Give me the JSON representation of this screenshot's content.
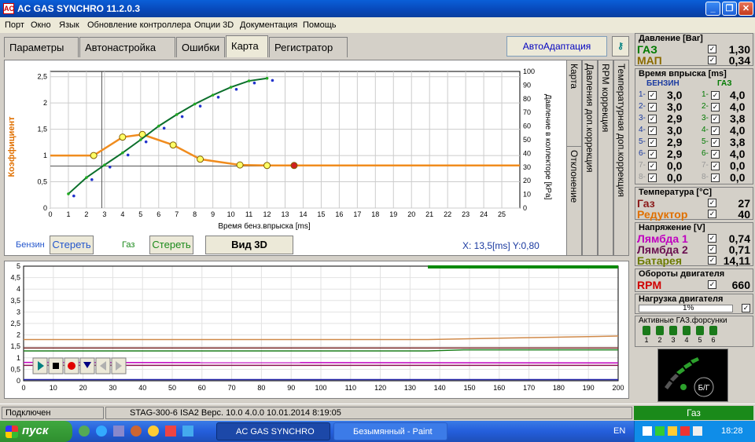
{
  "window": {
    "title": "AC GAS SYNCHRO  11.2.0.3",
    "app_icon": "AC"
  },
  "menu": [
    "Порт",
    "Окно",
    "Язык",
    "Обновление контроллера",
    "Опции 3D",
    "Документация",
    "Помощь"
  ],
  "tabs": [
    "Параметры",
    "Автонастройка",
    "Ошибки",
    "Карта",
    "Регистратор"
  ],
  "active_tab": "Карта",
  "auto_adapt_label": "АвтоАдаптация",
  "side_tabs": [
    "Карта",
    "Давления доп.коррекция",
    "RPM коррекция",
    "Температурная доп.коррекция",
    "Отклонение"
  ],
  "map_chart": {
    "ylabel": "Коэффициент",
    "xlabel": "Время бенз.впрыска [ms]",
    "y2label": "Давление в коллекторе [kPa]",
    "petrol_label": "Бензин",
    "gas_label": "Газ",
    "clear_label": "Стереть",
    "view3d_label": "Вид 3D",
    "cursor_readout": "X: 13,5[ms]  Y:0,80"
  },
  "chart_data": [
    {
      "type": "line",
      "title": "",
      "xlabel": "Время бенз.впрыска [ms]",
      "ylabel": "Коэффициент",
      "y2label": "Давление в коллекторе [kPa]",
      "xlim": [
        0,
        26
      ],
      "ylim": [
        0,
        2.6
      ],
      "y2lim": [
        0,
        100
      ],
      "x_ticks": [
        0,
        1,
        2,
        3,
        4,
        5,
        6,
        7,
        8,
        9,
        10,
        11,
        12,
        13,
        14,
        15,
        16,
        17,
        18,
        19,
        20,
        21,
        22,
        23,
        24,
        25
      ],
      "y_ticks": [
        "0",
        "0,5",
        "1",
        "1,5",
        "2",
        "2,5"
      ],
      "y2_ticks": [
        0,
        10,
        20,
        30,
        40,
        50,
        60,
        70,
        80,
        90,
        100
      ],
      "series": [
        {
          "color": "#f08c1e",
          "x": [
            0,
            2.4,
            4.0,
            5.1,
            6.8,
            8.3,
            10.5,
            12.0,
            13.5,
            26
          ],
          "y": [
            1.0,
            1.0,
            1.35,
            1.4,
            1.2,
            0.93,
            0.82,
            0.81,
            0.81,
            0.81
          ]
        },
        {
          "color": "#0b6f2b",
          "x": [
            1.0,
            2.0,
            3.0,
            4.0,
            5.0,
            6.0,
            7.0,
            8.0,
            9.0,
            10.0,
            11.0,
            12.0
          ],
          "y": [
            0.27,
            0.58,
            0.82,
            1.05,
            1.3,
            1.56,
            1.78,
            1.98,
            2.15,
            2.3,
            2.42,
            2.47
          ]
        }
      ],
      "crosshair": {
        "x": 2.85,
        "y": 0.8
      },
      "selected_point": {
        "x": 13.5,
        "y": 0.8
      }
    },
    {
      "type": "line",
      "title": "",
      "xlim": [
        0,
        200
      ],
      "ylim": [
        0,
        5
      ],
      "x_ticks": [
        0,
        10,
        20,
        30,
        40,
        50,
        60,
        70,
        80,
        90,
        100,
        110,
        120,
        130,
        140,
        150,
        160,
        170,
        180,
        190,
        200
      ],
      "y_ticks": [
        "0",
        "0,5",
        "1",
        "1,5",
        "2",
        "2,5",
        "3",
        "3,5",
        "4",
        "4,5",
        "5"
      ],
      "series": [
        {
          "color": "#d08a4a",
          "x": [
            0,
            136,
            200
          ],
          "y": [
            1.8,
            1.8,
            1.95
          ]
        },
        {
          "color": "#7b2a2a",
          "x": [
            0,
            200
          ],
          "y": [
            1.43,
            1.43
          ]
        },
        {
          "color": "#1b7f1b",
          "x": [
            0,
            136,
            148,
            200
          ],
          "y": [
            1.3,
            1.3,
            1.35,
            1.35
          ]
        },
        {
          "color": "#c000c0",
          "x": [
            0,
            200
          ],
          "y": [
            0.8,
            0.78
          ]
        },
        {
          "color": "#8a1050",
          "x": [
            0,
            200
          ],
          "y": [
            0.67,
            0.67
          ]
        },
        {
          "color": "#2222aa",
          "x": [
            0,
            140,
            200
          ],
          "y": [
            0.05,
            0.05,
            0.05
          ]
        }
      ],
      "green_bar": {
        "x": [
          136,
          200
        ],
        "y": 5
      }
    }
  ],
  "right_panel": {
    "pressure": {
      "title": "Давление [Bar]",
      "rows": [
        {
          "label": "ГАЗ",
          "value": "1,30"
        },
        {
          "label": "МАП",
          "value": "0,34"
        }
      ]
    },
    "injection": {
      "title": "Время впрыска [ms]",
      "petrol": "БЕНЗИН",
      "gas": "ГАЗ",
      "petrol_values": [
        "3,0",
        "3,0",
        "2,9",
        "3,0",
        "2,9",
        "2,9",
        "0,0",
        "0,0"
      ],
      "gas_values": [
        "4,0",
        "4,0",
        "3,8",
        "4,0",
        "3,8",
        "4,0",
        "0,0",
        "0,0"
      ]
    },
    "temperature": {
      "title": "Температура [°C]",
      "rows": [
        {
          "label": "Газ",
          "value": "27"
        },
        {
          "label": "Редуктор",
          "value": "40"
        }
      ]
    },
    "voltage": {
      "title": "Напряжение [V]",
      "rows": [
        {
          "label": "Лямбда 1",
          "value": "0,74"
        },
        {
          "label": "Лямбда 2",
          "value": "0,71"
        },
        {
          "label": "Батарея",
          "value": "14,11"
        }
      ]
    },
    "rpm": {
      "title": "Обороты двигателя",
      "label": "RPM",
      "value": "660"
    },
    "load": {
      "title": "Нагрузка двигателя",
      "value": "1%"
    },
    "injectors": {
      "title": "Активные ГАЗ.форсунки",
      "labels": [
        "1",
        "2",
        "3",
        "4",
        "5",
        "6"
      ]
    },
    "indicator": "Б/Г"
  },
  "status": {
    "connected": "Подключен",
    "device": "STAG-300-6 ISA2  Верс. 10.0  4.0.0   10.01.2014 8:19:05",
    "mode": "Газ"
  },
  "taskbar": {
    "start": "пуск",
    "items": [
      "AC GAS SYNCHRO",
      "Безымянный - Paint"
    ],
    "lang": "EN",
    "time": "18:28"
  }
}
